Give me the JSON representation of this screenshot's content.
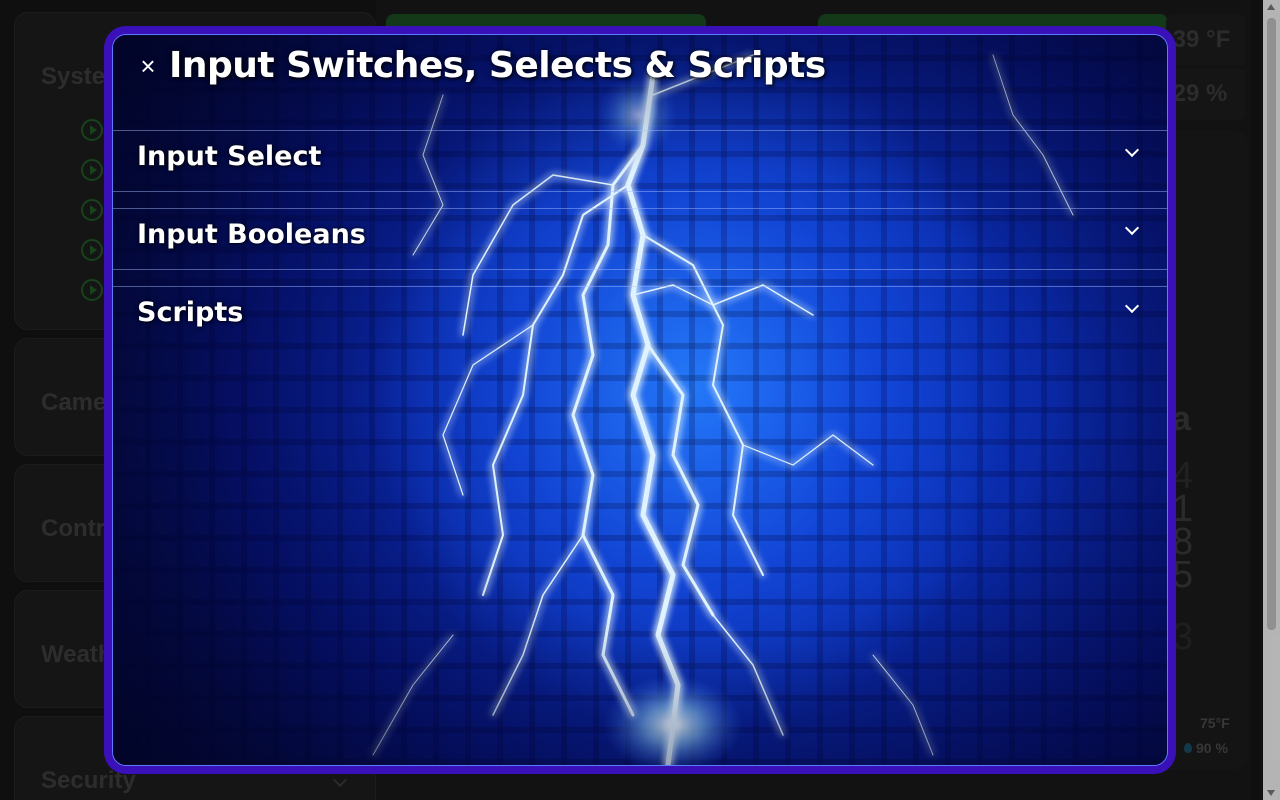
{
  "background": {
    "cards": [
      {
        "title": "Syste"
      },
      {
        "title": "Came"
      },
      {
        "title": "Contr"
      },
      {
        "title": "Weath"
      },
      {
        "title": "Security"
      }
    ],
    "stats": [
      ".39 °F",
      ".29 %"
    ],
    "right_panel": {
      "label": "a",
      "numbers": [
        "4",
        "1",
        "8",
        "5",
        "3"
      ],
      "temperature": "75°F",
      "humidity": "90 %"
    }
  },
  "dialog": {
    "title": "Input Switches, Selects & Scripts",
    "close_icon": "close-icon",
    "sections": [
      {
        "label": "Input Select",
        "expanded": false
      },
      {
        "label": "Input Booleans",
        "expanded": false
      },
      {
        "label": "Scripts",
        "expanded": false
      }
    ],
    "colors": {
      "frame": "#3a10b8",
      "background_primary": "#0d3fd6",
      "text": "#ffffff"
    }
  }
}
